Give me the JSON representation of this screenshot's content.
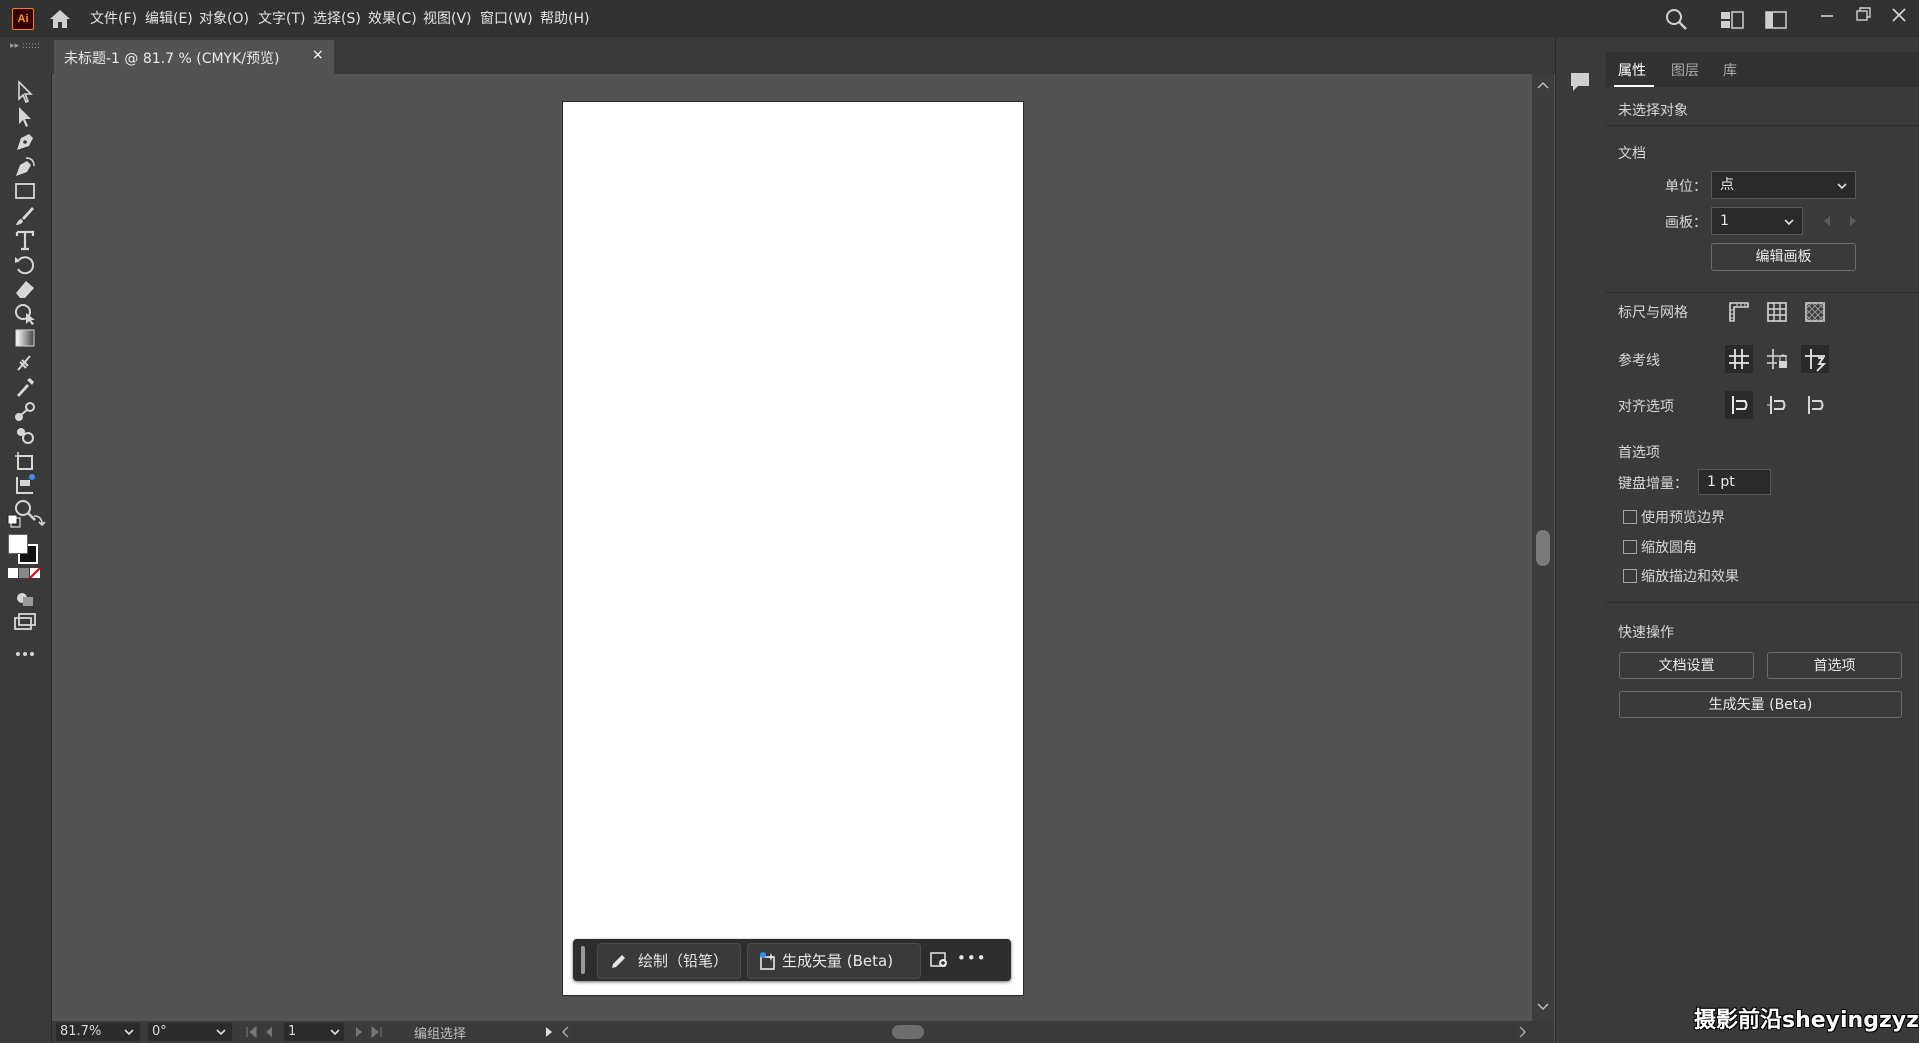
{
  "app": {
    "logo": "Ai"
  },
  "menu": [
    "文件(F)",
    "编辑(E)",
    "对象(O)",
    "文字(T)",
    "选择(S)",
    "效果(C)",
    "视图(V)",
    "窗口(W)",
    "帮助(H)"
  ],
  "document_tab": {
    "title": "未标题-1 @ 81.7 % (CMYK/预览)",
    "close": "×"
  },
  "context_bar": {
    "draw_label": "绘制（铅笔）",
    "generate_label": "生成矢量 (Beta)",
    "more": "•••"
  },
  "status_bar": {
    "zoom": "81.7%",
    "rotation": "0°",
    "artboard": "1",
    "mode": "编组选择"
  },
  "properties_panel": {
    "tabs": [
      "属性",
      "图层",
      "库"
    ],
    "active_tab": "属性",
    "selection_state": "未选择对象",
    "document_section": "文档",
    "units_label": "单位：",
    "units_value": "点",
    "artboard_label": "画板：",
    "artboard_value": "1",
    "edit_artboard_button": "编辑画板",
    "rulers_grid_label": "标尺与网格",
    "guides_label": "参考线",
    "snap_label": "对齐选项",
    "preferences_section": "首选项",
    "keyboard_increment_label": "键盘增量：",
    "keyboard_increment_value": "1 pt",
    "checkboxes": [
      {
        "label": "使用预览边界",
        "checked": false
      },
      {
        "label": "缩放圆角",
        "checked": false
      },
      {
        "label": "缩放描边和效果",
        "checked": false
      }
    ],
    "quick_actions_section": "快速操作",
    "document_setup_button": "文档设置",
    "preferences_button": "首选项",
    "generate_vector_button": "生成矢量 (Beta)"
  },
  "watermark": "摄影前沿sheyingzyz.com",
  "colors": {
    "menubar": "#323232",
    "panel": "#3a3a3a",
    "canvas": "#535353",
    "artboard": "#ffffff",
    "accent_logo": "#ff9a00"
  },
  "icons": [
    "home-icon",
    "search-icon",
    "arrange-icon",
    "workspace-icon",
    "minimize-icon",
    "restore-icon",
    "close-icon",
    "comment-icon"
  ]
}
